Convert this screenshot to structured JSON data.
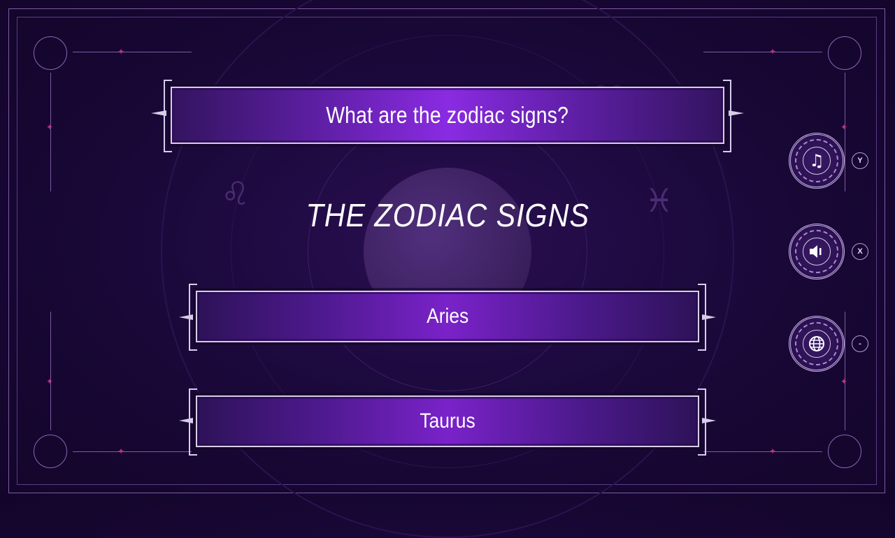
{
  "question": {
    "text": "What are the zodiac signs?"
  },
  "title": {
    "text": "THE ZODIAC SIGNS"
  },
  "answers": [
    {
      "label": "Aries"
    },
    {
      "label": "Taurus"
    }
  ],
  "side_buttons": [
    {
      "icon": "music-note-icon",
      "glyph": "♫",
      "key": "Y"
    },
    {
      "icon": "speaker-icon",
      "glyph": "🔈",
      "key": "X"
    },
    {
      "icon": "globe-icon",
      "glyph": "🌐",
      "key": "-"
    }
  ],
  "colors": {
    "accent": "#8a2be2",
    "frame": "#d8cde8",
    "background": "#1e0a40",
    "ornament_star": "#c2307a"
  }
}
